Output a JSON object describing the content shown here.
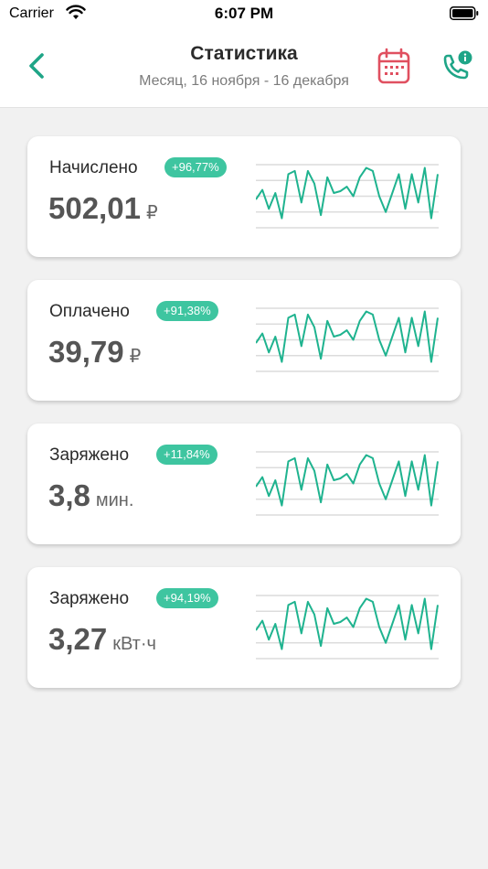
{
  "status_bar": {
    "carrier": "Carrier",
    "time": "6:07 PM"
  },
  "header": {
    "title": "Статистика",
    "subtitle": "Месяц, 16 ноября - 16 декабря",
    "back_icon": "chevron-left-icon",
    "calendar_icon": "calendar-icon",
    "support_icon": "phone-info-icon"
  },
  "colors": {
    "accent": "#1fa587",
    "badge": "#3ec5a0",
    "calendar": "#e05060",
    "sparkline": "#1fb38f"
  },
  "cards": [
    {
      "title": "Начислено",
      "badge": "+96,77%",
      "value": "502,01",
      "unit": "₽",
      "trend": [
        0.45,
        0.6,
        0.3,
        0.55,
        0.15,
        0.85,
        0.9,
        0.4,
        0.9,
        0.7,
        0.2,
        0.8,
        0.55,
        0.58,
        0.65,
        0.5,
        0.8,
        0.95,
        0.9,
        0.5,
        0.25,
        0.55,
        0.85,
        0.3,
        0.85,
        0.4,
        0.95,
        0.15,
        0.85
      ]
    },
    {
      "title": "Оплачено",
      "badge": "+91,38%",
      "value": "39,79",
      "unit": "₽",
      "trend": [
        0.45,
        0.6,
        0.3,
        0.55,
        0.15,
        0.85,
        0.9,
        0.4,
        0.9,
        0.7,
        0.2,
        0.8,
        0.55,
        0.58,
        0.65,
        0.5,
        0.8,
        0.95,
        0.9,
        0.5,
        0.25,
        0.55,
        0.85,
        0.3,
        0.85,
        0.4,
        0.95,
        0.15,
        0.85
      ]
    },
    {
      "title": "Заряжено",
      "badge": "+11,84%",
      "value": "3,8",
      "unit": "мин.",
      "trend": [
        0.45,
        0.6,
        0.3,
        0.55,
        0.15,
        0.85,
        0.9,
        0.4,
        0.9,
        0.7,
        0.2,
        0.8,
        0.55,
        0.58,
        0.65,
        0.5,
        0.8,
        0.95,
        0.9,
        0.5,
        0.25,
        0.55,
        0.85,
        0.3,
        0.85,
        0.4,
        0.95,
        0.15,
        0.85
      ]
    },
    {
      "title": "Заряжено",
      "badge": "+94,19%",
      "value": "3,27",
      "unit": "кВт·ч",
      "trend": [
        0.45,
        0.6,
        0.3,
        0.55,
        0.15,
        0.85,
        0.9,
        0.4,
        0.9,
        0.7,
        0.2,
        0.8,
        0.55,
        0.58,
        0.65,
        0.5,
        0.8,
        0.95,
        0.9,
        0.5,
        0.25,
        0.55,
        0.85,
        0.3,
        0.85,
        0.4,
        0.95,
        0.15,
        0.85
      ]
    }
  ]
}
